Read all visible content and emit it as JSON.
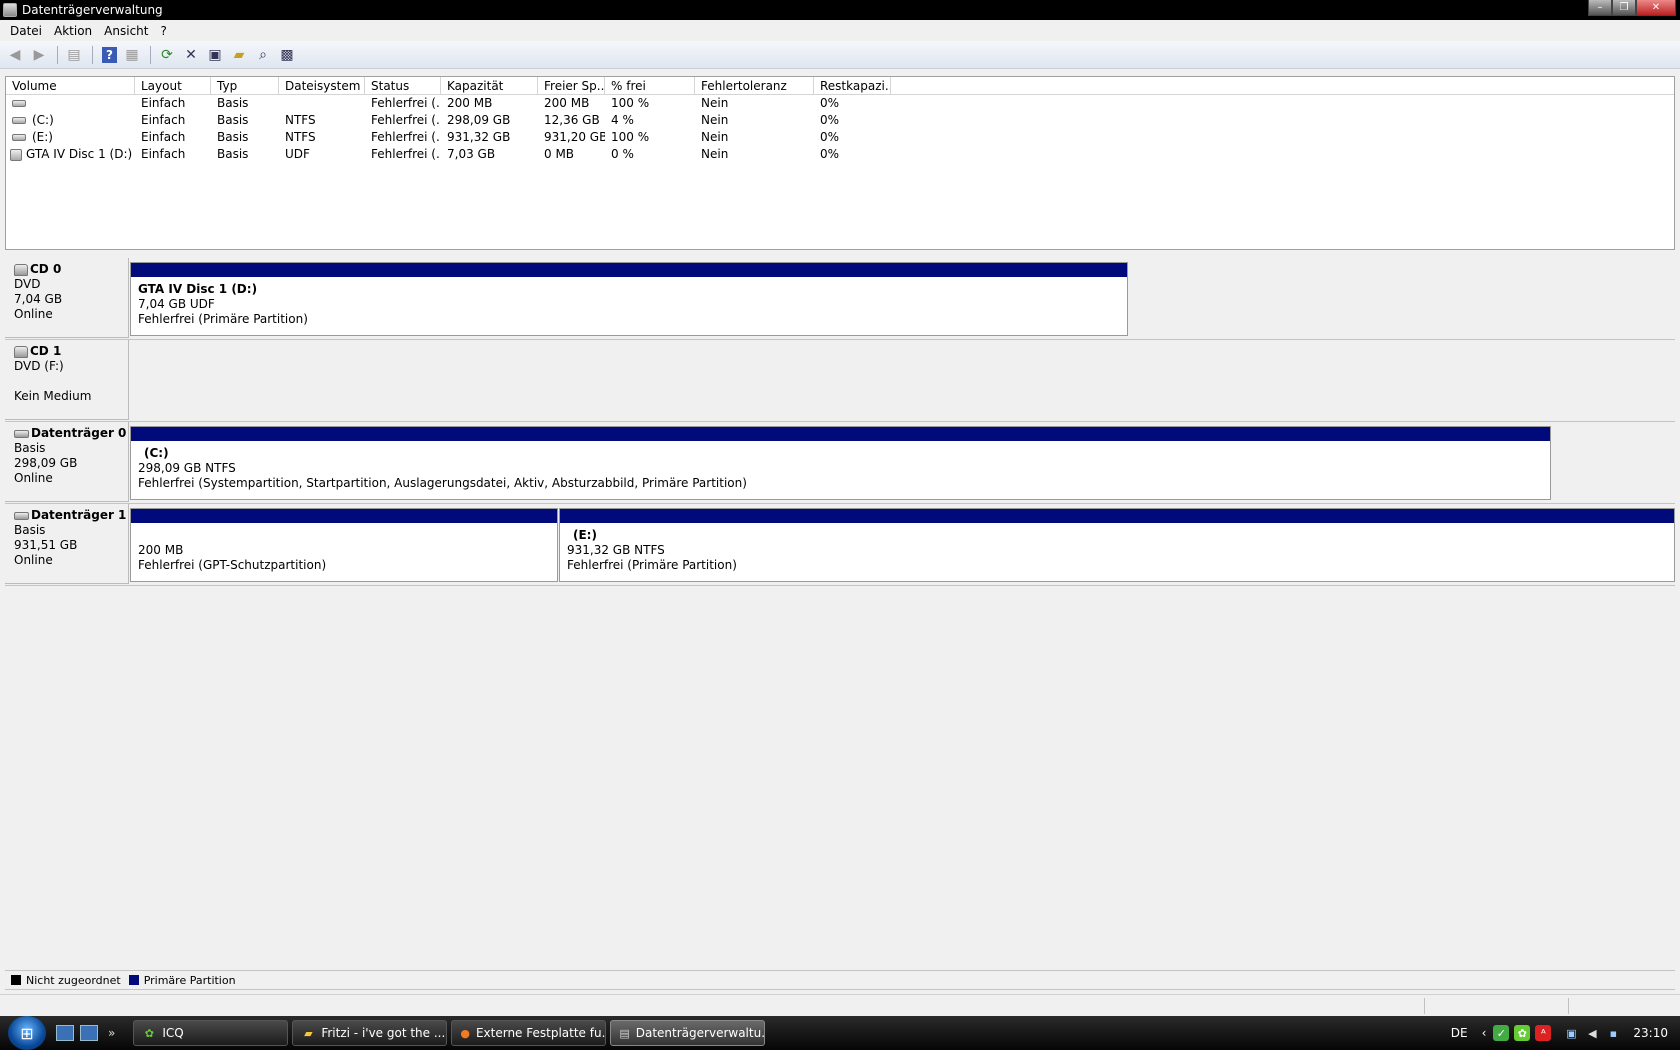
{
  "window": {
    "title": "Datenträgerverwaltung",
    "controls": {
      "minimize": "–",
      "maximize": "❐",
      "close": "✕"
    }
  },
  "menu": [
    "Datei",
    "Aktion",
    "Ansicht",
    "?"
  ],
  "toolbar": {
    "icons": [
      "back-icon",
      "forward-icon",
      "show-hide-console-tree-icon",
      "help-icon",
      "show-action-pane-icon",
      "refresh-icon",
      "delete-icon",
      "properties-icon",
      "open-icon",
      "find-icon",
      "settings-icon"
    ]
  },
  "volume_list": {
    "columns": [
      "Volume",
      "Layout",
      "Typ",
      "Dateisystem",
      "Status",
      "Kapazität",
      "Freier Sp...",
      "% frei",
      "Fehlertoleranz",
      "Restkapazi..."
    ],
    "rows": [
      {
        "volume": "",
        "layout": "Einfach",
        "typ": "Basis",
        "fs": "",
        "status": "Fehlerfrei (...",
        "cap": "200 MB",
        "free": "200 MB",
        "pct": "100 %",
        "ft": "Nein",
        "rest": "0%",
        "icon": "disk"
      },
      {
        "volume": "(C:)",
        "layout": "Einfach",
        "typ": "Basis",
        "fs": "NTFS",
        "status": "Fehlerfrei (...",
        "cap": "298,09 GB",
        "free": "12,36 GB",
        "pct": "4 %",
        "ft": "Nein",
        "rest": "0%",
        "icon": "disk"
      },
      {
        "volume": "(E:)",
        "layout": "Einfach",
        "typ": "Basis",
        "fs": "NTFS",
        "status": "Fehlerfrei (...",
        "cap": "931,32 GB",
        "free": "931,20 GB",
        "pct": "100 %",
        "ft": "Nein",
        "rest": "0%",
        "icon": "disk"
      },
      {
        "volume": "GTA IV Disc 1 (D:)",
        "layout": "Einfach",
        "typ": "Basis",
        "fs": "UDF",
        "status": "Fehlerfrei (...",
        "cap": "7,03 GB",
        "free": "0 MB",
        "pct": "0 %",
        "ft": "Nein",
        "rest": "0%",
        "icon": "cd"
      }
    ]
  },
  "disks": {
    "cd0": {
      "name": "CD 0",
      "line1": "DVD",
      "line2": "7,04 GB",
      "line3": "Online",
      "part": {
        "name": "GTA IV Disc 1  (D:)",
        "size": "7,04 GB UDF",
        "status": "Fehlerfrei (Primäre Partition)"
      }
    },
    "cd1": {
      "name": "CD 1",
      "line1": "DVD (F:)",
      "line2": "",
      "line3": "Kein Medium"
    },
    "disk0": {
      "name": "Datenträger 0",
      "line1": "Basis",
      "line2": "298,09 GB",
      "line3": "Online",
      "part": {
        "name": "(C:)",
        "size": "298,09 GB NTFS",
        "status": "Fehlerfrei (Systempartition, Startpartition, Auslagerungsdatei, Aktiv, Absturzabbild, Primäre Partition)"
      }
    },
    "disk1": {
      "name": "Datenträger 1",
      "line1": "Basis",
      "line2": "931,51 GB",
      "line3": "Online",
      "part_a": {
        "size": "200 MB",
        "status": "Fehlerfrei (GPT-Schutzpartition)"
      },
      "part_b": {
        "name": "(E:)",
        "size": "931,32 GB NTFS",
        "status": "Fehlerfrei (Primäre Partition)"
      }
    }
  },
  "legend": {
    "unallocated": "Nicht zugeordnet",
    "primary": "Primäre Partition",
    "colors": {
      "unallocated": "#000000",
      "primary": "#000a7a"
    }
  },
  "taskbar": {
    "start_glyph": "⊞",
    "quicklaunch_more": "»",
    "tasks": [
      {
        "label": "ICQ",
        "icon": "icq-icon"
      },
      {
        "label": "Fritzi - i've got the ...",
        "icon": "folder-icon"
      },
      {
        "label": "Externe Festplatte fu...",
        "icon": "firefox-icon"
      },
      {
        "label": "Datenträgerverwaltu...",
        "icon": "disk-management-icon"
      }
    ],
    "tray": {
      "lang": "DE",
      "expand": "‹",
      "clock": "23:10"
    }
  }
}
